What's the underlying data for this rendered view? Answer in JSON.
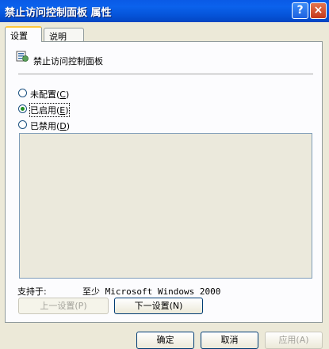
{
  "window": {
    "title": "禁止访问控制面板 属性",
    "help_label": "?",
    "close_label": "×"
  },
  "tabs": [
    {
      "label": "设置"
    },
    {
      "label": "说明"
    }
  ],
  "settings": {
    "policy_name": "禁止访问控制面板",
    "options": [
      {
        "label": "未配置",
        "accel": "C",
        "selected": false
      },
      {
        "label": "已启用",
        "accel": "E",
        "selected": true
      },
      {
        "label": "已禁用",
        "accel": "D",
        "selected": false
      }
    ],
    "supported_label": "支持于:",
    "supported_value": "至少 Microsoft Windows 2000",
    "prev_button": "上一设置(P)",
    "next_button": "下一设置(N)"
  },
  "footer": {
    "ok": "确定",
    "cancel": "取消",
    "apply": "应用(A)"
  },
  "colors": {
    "titlebar": "#0553d8",
    "face": "#ece9d8",
    "tab_highlight": "#ffc73c"
  }
}
